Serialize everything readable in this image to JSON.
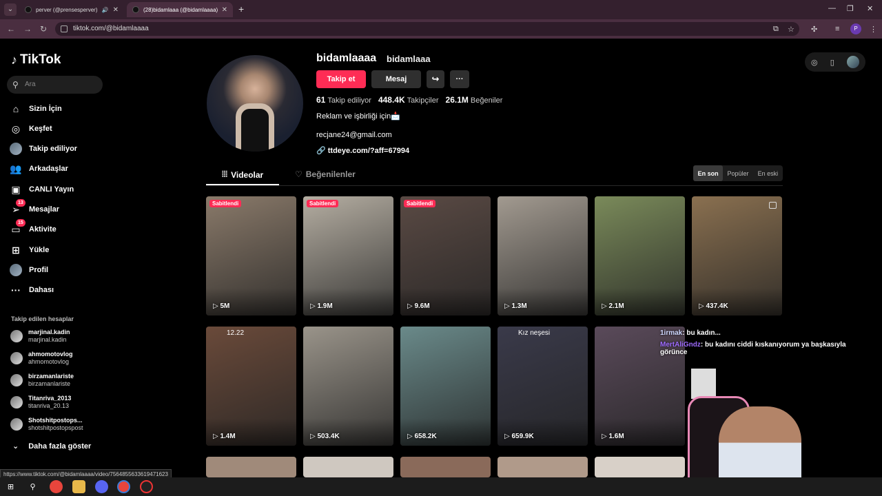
{
  "browser": {
    "tabs": [
      {
        "title": "perver (@prensesperver) | T",
        "active": false
      },
      {
        "title": "(28)bidamlaaa (@bidamlaaaa)",
        "active": true
      }
    ],
    "url": "tiktok.com/@bidamlaaaa",
    "profile_initial": "P",
    "status_url": "https://www.tiktok.com/@bidamlaaaa/video/7564855633619471623"
  },
  "sidebar": {
    "logo": "TikTok",
    "search_placeholder": "Ara",
    "items": [
      {
        "label": "Sizin İçin",
        "icon": "home-icon",
        "badge": ""
      },
      {
        "label": "Keşfet",
        "icon": "compass-icon",
        "badge": ""
      },
      {
        "label": "Takip ediliyor",
        "icon": "following-avatar-icon",
        "badge": ""
      },
      {
        "label": "Arkadaşlar",
        "icon": "friends-icon",
        "badge": ""
      },
      {
        "label": "CANLI Yayın",
        "icon": "live-icon",
        "badge": ""
      },
      {
        "label": "Mesajlar",
        "icon": "message-icon",
        "badge": "13"
      },
      {
        "label": "Aktivite",
        "icon": "activity-icon",
        "badge": "15"
      },
      {
        "label": "Yükle",
        "icon": "upload-icon",
        "badge": ""
      },
      {
        "label": "Profil",
        "icon": "profile-icon",
        "badge": ""
      },
      {
        "label": "Dahası",
        "icon": "more-icon",
        "badge": ""
      }
    ],
    "followed_title": "Takip edilen hesaplar",
    "followed": [
      {
        "name": "marjinal.kadin",
        "username": "marjinal.kadin"
      },
      {
        "name": "ahmomotovlog",
        "username": "ahmomotovlog"
      },
      {
        "name": "birzamanlariste",
        "username": "birzamanlariste"
      },
      {
        "name": "Titanriva_2013",
        "username": "titanriva_20.13"
      },
      {
        "name": "Shotshitpostops...",
        "username": "shotshitpostopspost"
      }
    ],
    "show_more": "Daha fazla göster"
  },
  "profile": {
    "username": "bidamlaaaa",
    "nickname": "bidamlaaa",
    "follow_label": "Takip et",
    "message_label": "Mesaj",
    "stats": {
      "following": "61",
      "following_label": "Takip ediliyor",
      "followers": "448.4K",
      "followers_label": "Takipçiler",
      "likes": "26.1M",
      "likes_label": "Beğeniler"
    },
    "bio": "Reklam ve işbirliği için📩",
    "email": "recjane24@gmail.com",
    "link": "ttdeye.com/?aff=67994"
  },
  "tabs": {
    "videos": "Videolar",
    "liked": "Beğenilenler"
  },
  "sort": {
    "options": [
      "En son",
      "Popüler",
      "En eski"
    ],
    "selected": "En son"
  },
  "videos": [
    {
      "views": "5M",
      "pinned": "Sabitlendi",
      "color": "#8a7a6a"
    },
    {
      "views": "1.9M",
      "pinned": "Sabitlendi",
      "color": "#b5aea2"
    },
    {
      "views": "9.6M",
      "pinned": "Sabitlendi",
      "color": "#5a4a44"
    },
    {
      "views": "1.3M",
      "pinned": "",
      "color": "#a29a90"
    },
    {
      "views": "2.1M",
      "pinned": "",
      "color": "#7a8a5a"
    },
    {
      "views": "437.4K",
      "pinned": "",
      "color": "#8a7050"
    },
    {
      "views": "1.4M",
      "pinned": "",
      "color": "#6a4a3a",
      "overlay_text": "12.22"
    },
    {
      "views": "503.4K",
      "pinned": "",
      "color": "#9a948a"
    },
    {
      "views": "658.2K",
      "pinned": "",
      "color": "#6a8a8a"
    },
    {
      "views": "659.9K",
      "pinned": "",
      "color": "#3a3a4a",
      "overlay_text": "Kız neşesi"
    },
    {
      "views": "1.6M",
      "pinned": "",
      "color": "#5a4a5a"
    }
  ],
  "stream_chat": [
    {
      "user": "1irmak",
      "text": ": bu kadın..."
    },
    {
      "user": "MertAliGndz",
      "text": ": bu kadını ciddi kıskanıyorum ya başkasıyla görünce"
    }
  ],
  "colors": {
    "accent": "#fe2c55",
    "background": "#000000",
    "browser_chrome": "#4a2e40"
  }
}
